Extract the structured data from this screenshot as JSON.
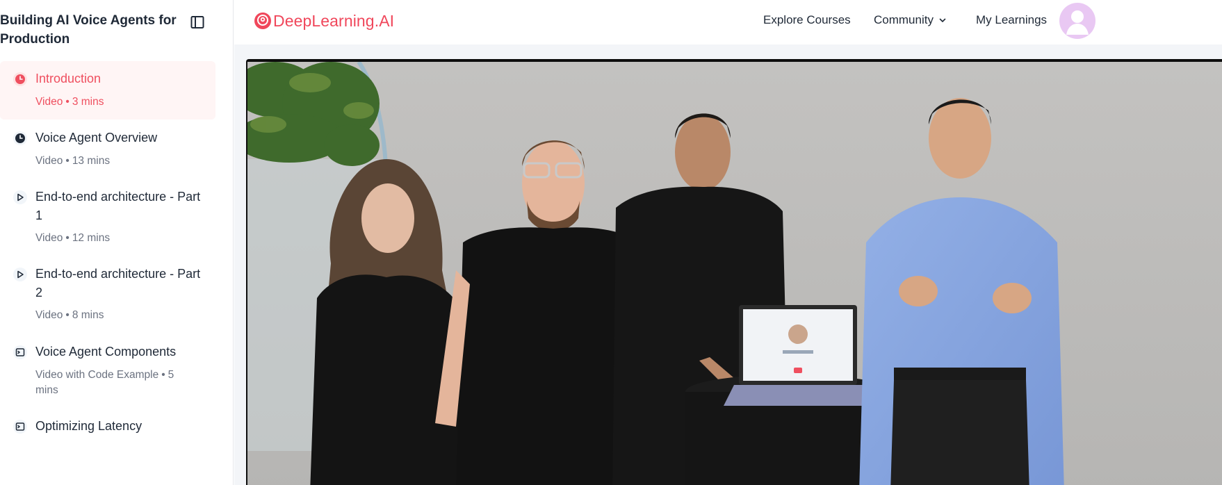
{
  "sidebar": {
    "course_title": "Building AI Voice Agents for Production",
    "lessons": [
      {
        "title": "Introduction",
        "type": "Video",
        "duration": "3 mins",
        "icon": "clock-icon",
        "active": true
      },
      {
        "title": "Voice Agent Overview",
        "type": "Video",
        "duration": "13 mins",
        "icon": "clock-icon",
        "active": false
      },
      {
        "title": "End-to-end architecture - Part 1",
        "type": "Video",
        "duration": "12 mins",
        "icon": "play-icon",
        "active": false
      },
      {
        "title": "End-to-end architecture - Part 2",
        "type": "Video",
        "duration": "8 mins",
        "icon": "play-icon",
        "active": false
      },
      {
        "title": "Voice Agent Components",
        "type": "Video with Code Example",
        "duration": "5 mins",
        "icon": "code-icon",
        "active": false
      },
      {
        "title": "Optimizing Latency",
        "type": "",
        "duration": "",
        "icon": "code-icon",
        "active": false
      }
    ]
  },
  "header": {
    "logo_text": "DeepLearning.AI",
    "nav": {
      "explore": "Explore Courses",
      "community": "Community",
      "learnings": "My Learnings"
    }
  },
  "colors": {
    "brand": "#f0475b",
    "active_bg": "#fff5f5",
    "text": "#1f2937",
    "muted": "#6b7280"
  }
}
